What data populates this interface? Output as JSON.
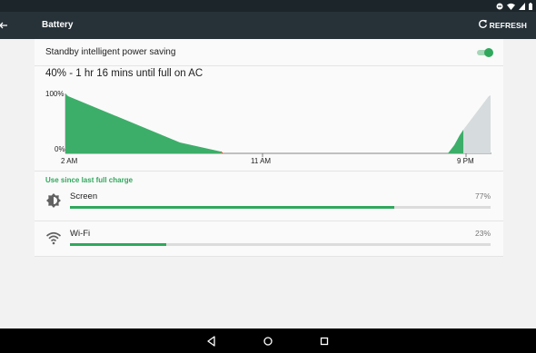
{
  "header": {
    "title": "Battery",
    "refresh_label": "REFRESH"
  },
  "settings": {
    "standby_label": "Standby intelligent power saving",
    "standby_enabled": true
  },
  "battery": {
    "summary": "40% - 1 hr 16 mins until full on AC",
    "graph": {
      "y_labels": [
        "100%",
        "0%"
      ],
      "x_labels": [
        "2 AM",
        "11 AM",
        "9 PM"
      ],
      "discharge_color": "#3dae69",
      "projection_color": "#d6dbdd"
    }
  },
  "usage": {
    "section_title": "Use since last full charge",
    "items": [
      {
        "label": "Screen",
        "percent_text": "77%",
        "fraction": 0.77,
        "icon": "brightness-icon"
      },
      {
        "label": "Wi-Fi",
        "percent_text": "23%",
        "fraction": 0.23,
        "icon": "wifi-icon"
      }
    ]
  },
  "colors": {
    "accent": "#2fa85c",
    "toolbar": "#263238",
    "status_bar": "#1c2529"
  }
}
